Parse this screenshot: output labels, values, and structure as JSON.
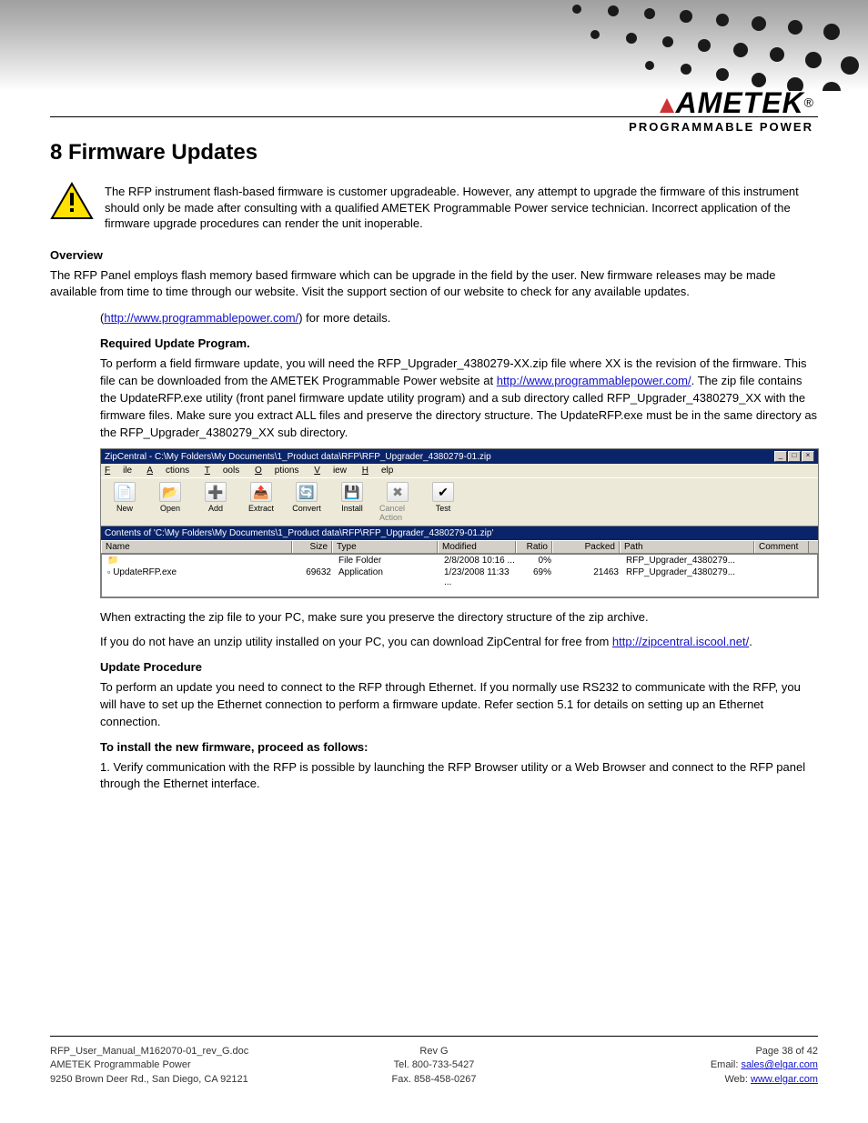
{
  "logo": {
    "brand": "AMETEK",
    "sub": "PROGRAMMABLE POWER",
    "reg": "®"
  },
  "title": "8 Firmware Updates",
  "warning": "The RFP instrument flash-based firmware is customer upgradeable.  However, any attempt to upgrade the firmware of this instrument should only be made after consulting with a qualified AMETEK Programmable Power service technician.  Incorrect application of the firmware upgrade procedures can render the unit inoperable.",
  "overview_h": "Overview",
  "overview_p": "The RFP Panel employs flash memory based firmware which can be upgrade in the field by the user.  New firmware releases may be made available from time to time through our website.  Visit the support section of our website to check for any available updates.",
  "website_url": "http://www.programmablepower.com/",
  "overview_p2": " for more details.",
  "required_h": "Required Update Program.",
  "required_p": "To perform a field firmware update, you will need the RFP_Upgrader_4380279-XX.zip file where XX is the revision of the firmware. This file can be downloaded from the AMETEK Programmable Power website at ",
  "required_p2": ". The zip file contains the UpdateRFP.exe utility (front panel firmware update utility program) and a sub directory called RFP_Upgrader_4380279_XX with the firmware files. Make sure you extract ALL files and preserve the directory structure. The UpdateRFP.exe must be in the same directory as the RFP_Upgrader_4380279_XX sub directory.",
  "zip": {
    "title": "ZipCentral - C:\\My Folders\\My Documents\\1_Product data\\RFP\\RFP_Upgrader_4380279-01.zip",
    "menus": {
      "file": "File",
      "actions": "Actions",
      "tools": "Tools",
      "options": "Options",
      "view": "View",
      "help": "Help"
    },
    "buttons": {
      "new": "New",
      "open": "Open",
      "add": "Add",
      "extract": "Extract",
      "convert": "Convert",
      "install": "Install",
      "cancel": "Cancel Action",
      "test": "Test"
    },
    "contents": "Contents of 'C:\\My Folders\\My Documents\\1_Product data\\RFP\\RFP_Upgrader_4380279-01.zip'",
    "cols": {
      "name": "Name",
      "size": "Size",
      "type": "Type",
      "modified": "Modified",
      "ratio": "Ratio",
      "packed": "Packed",
      "path": "Path",
      "comment": "Comment"
    },
    "rows": [
      {
        "name": "",
        "size": "",
        "type": "File Folder",
        "modified": "2/8/2008 10:16 ...",
        "ratio": "0%",
        "packed": "",
        "path": "RFP_Upgrader_4380279..."
      },
      {
        "name": "UpdateRFP.exe",
        "size": "69632",
        "type": "Application",
        "modified": "1/23/2008 11:33 ...",
        "ratio": "69%",
        "packed": "21463",
        "path": "RFP_Upgrader_4380279..."
      }
    ]
  },
  "extract_p1": "When extracting the zip file to your PC, make sure you preserve the directory structure of the zip archive.",
  "zipcentral_p": "If you do not have an unzip utility installed on your PC, you can download ZipCentral for free from ",
  "zipcentral_link": "http://zipcentral.iscool.net/",
  "zipcentral_p2": ".",
  "update_h": "Update Procedure",
  "update_p": "To perform an update you need to connect to the RFP through Ethernet.  If you normally use RS232 to communicate with the RFP, you will have to set up the Ethernet connection to perform a firmware update. Refer section 5.1 for details on setting up an Ethernet connection.",
  "steps_h": "To install the new firmware, proceed as follows:",
  "step1": "1. Verify communication with the RFP is possible by launching the RFP Browser utility or a Web Browser and connect to the RFP panel through the Ethernet interface.",
  "footer": {
    "rev": "RFP_User_Manual_M162070-01_rev_G.doc",
    "revshort": "Rev G",
    "page": "Page 38 of 42",
    "company1": "AMETEK Programmable Power",
    "tel": "Tel. 800-733-5427",
    "email": "Email: sales@elgar.com",
    "addr": "9250 Brown Deer Rd., San Diego, CA 92121",
    "fax": "Fax. 858-458-0267",
    "web": "Web: www.elgar.com"
  }
}
